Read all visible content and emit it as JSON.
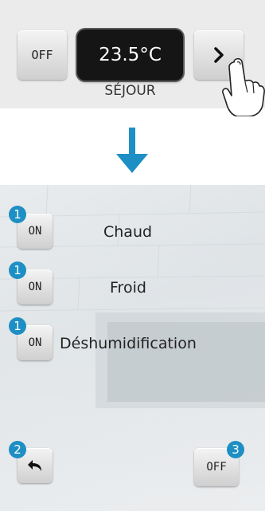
{
  "top_panel": {
    "off_button_label": "OFF",
    "temperature": "23.5°C",
    "zone_name": "SÉJOUR",
    "next_icon": "chevron-right-icon"
  },
  "arrow": {
    "icon": "arrow-down-icon",
    "color": "#1e8fc4"
  },
  "modes": [
    {
      "button_label": "ON",
      "label": "Chaud",
      "badge": "1"
    },
    {
      "button_label": "ON",
      "label": "Froid",
      "badge": "1"
    },
    {
      "button_label": "ON",
      "label": "Déshumidification",
      "badge": "1"
    }
  ],
  "bottom_controls": {
    "back_icon": "back-arrow-icon",
    "back_badge": "2",
    "off_button_label": "OFF",
    "off_badge": "3"
  },
  "colors": {
    "badge": "#1e8fc4",
    "display_bg": "#151515"
  }
}
